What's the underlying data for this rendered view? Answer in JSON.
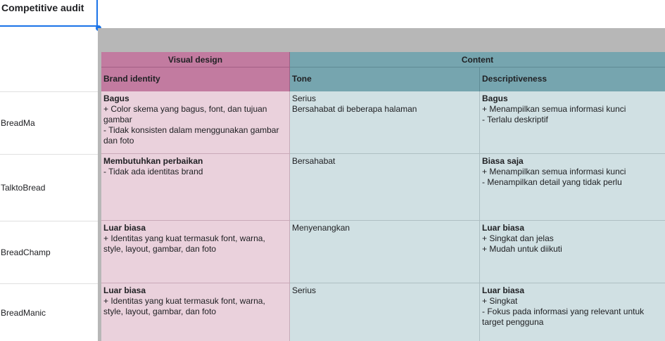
{
  "sheet": {
    "title_cell": "Competitive audit"
  },
  "headers": {
    "groups": {
      "visual": "Visual design",
      "content": "Content"
    },
    "columns": {
      "brand": "Brand identity",
      "tone": "Tone",
      "desc": "Descriptiveness"
    }
  },
  "rows": [
    {
      "name": "BreadMa",
      "brand": {
        "head": "Bagus",
        "lines": [
          "+ Color skema yang bagus, font, dan tujuan gambar",
          "-  Tidak konsisten dalam menggunakan gambar dan foto"
        ]
      },
      "tone": {
        "lines": [
          "Serius",
          "Bersahabat di beberapa halaman"
        ]
      },
      "desc": {
        "head": "Bagus",
        "lines": [
          "+ Menampilkan semua informasi kunci",
          "- Terlalu deskriptif"
        ]
      }
    },
    {
      "name": "TalktoBread",
      "brand": {
        "head": "Membutuhkan perbaikan",
        "lines": [
          "- Tidak ada identitas brand"
        ]
      },
      "tone": {
        "lines": [
          "Bersahabat"
        ]
      },
      "desc": {
        "head": "Biasa saja",
        "lines": [
          "+ Menampilkan semua informasi kunci",
          "- Menampilkan detail yang tidak perlu"
        ]
      }
    },
    {
      "name": "BreadChamp",
      "brand": {
        "head": "Luar biasa",
        "lines": [
          "+ Identitas yang kuat termasuk font, warna, style, layout, gambar, dan foto"
        ]
      },
      "tone": {
        "lines": [
          "Menyenangkan"
        ]
      },
      "desc": {
        "head": "Luar biasa",
        "lines": [
          "+ Singkat dan jelas",
          "+ Mudah untuk diikuti"
        ]
      }
    },
    {
      "name": "BreadManic",
      "brand": {
        "head": "Luar biasa",
        "lines": [
          "+ Identitas yang kuat termasuk font, warna, style, layout, gambar, dan foto"
        ]
      },
      "tone": {
        "lines": [
          "Serius"
        ]
      },
      "desc": {
        "head": "Luar biasa",
        "lines": [
          "+ Singkat",
          "- Fokus pada informasi yang relevant untuk target pengguna"
        ]
      }
    }
  ]
}
